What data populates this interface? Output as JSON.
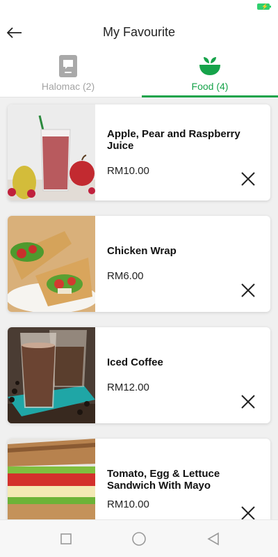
{
  "header": {
    "title": "My Favourite"
  },
  "tabs": [
    {
      "label": "Halomac (2)",
      "active": false
    },
    {
      "label": "Food (4)",
      "active": true
    }
  ],
  "favourites": [
    {
      "name": "Apple, Pear and Raspberry Juice",
      "price": "RM10.00"
    },
    {
      "name": "Chicken Wrap",
      "price": "RM6.00"
    },
    {
      "name": "Iced Coffee",
      "price": "RM12.00"
    },
    {
      "name": "Tomato, Egg & Lettuce Sandwich With Mayo",
      "price": "RM10.00"
    }
  ],
  "colors": {
    "accent": "#16a34a",
    "inactive": "#a3a3a3",
    "battery": "#2fd06e"
  }
}
